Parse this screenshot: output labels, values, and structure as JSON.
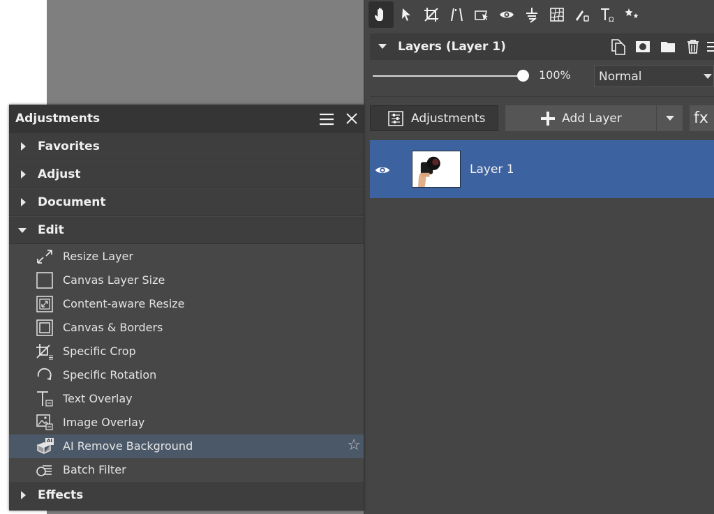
{
  "layers_panel": {
    "title": "Layers (Layer 1)",
    "opacity": "100%",
    "opacity_fraction": 1.0,
    "blend_mode": "Normal",
    "adjustments_button": "Adjustments",
    "add_layer_button": "Add Layer",
    "fx_button": "fx",
    "layers": [
      {
        "name": "Layer 1",
        "visible": true,
        "selected": true
      }
    ]
  },
  "toolbar": {
    "tools": [
      "hand-icon",
      "pointer-icon",
      "crop-icon",
      "straighten-icon",
      "perspective-icon",
      "eye-icon",
      "levels-icon",
      "warp-icon",
      "brush-icon",
      "text-icon",
      "effects-icon"
    ],
    "active_tool": "hand-icon"
  },
  "adjustments_panel": {
    "title": "Adjustments",
    "sections": [
      {
        "label": "Favorites",
        "expanded": false
      },
      {
        "label": "Adjust",
        "expanded": false
      },
      {
        "label": "Document",
        "expanded": false
      },
      {
        "label": "Edit",
        "expanded": true
      },
      {
        "label": "Effects",
        "expanded": false
      }
    ],
    "edit_items": [
      {
        "label": "Resize Layer",
        "icon": "resize-icon"
      },
      {
        "label": "Canvas Layer Size",
        "icon": "canvas-size-icon"
      },
      {
        "label": "Content-aware Resize",
        "icon": "content-aware-icon"
      },
      {
        "label": "Canvas & Borders",
        "icon": "borders-icon"
      },
      {
        "label": "Specific Crop",
        "icon": "crop-icon"
      },
      {
        "label": "Specific Rotation",
        "icon": "rotation-icon"
      },
      {
        "label": "Text Overlay",
        "icon": "text-overlay-icon"
      },
      {
        "label": "Image Overlay",
        "icon": "image-overlay-icon"
      },
      {
        "label": "AI Remove Background",
        "icon": "ai-remove-bg-icon",
        "highlighted": true
      },
      {
        "label": "Batch Filter",
        "icon": "batch-filter-icon"
      }
    ],
    "ai_badge": "AI"
  },
  "colors": {
    "panel_bg": "#454545",
    "selected_layer": "#3c62a0",
    "canvas": "#7f7f7f",
    "highlight_row": "#4b5868"
  }
}
